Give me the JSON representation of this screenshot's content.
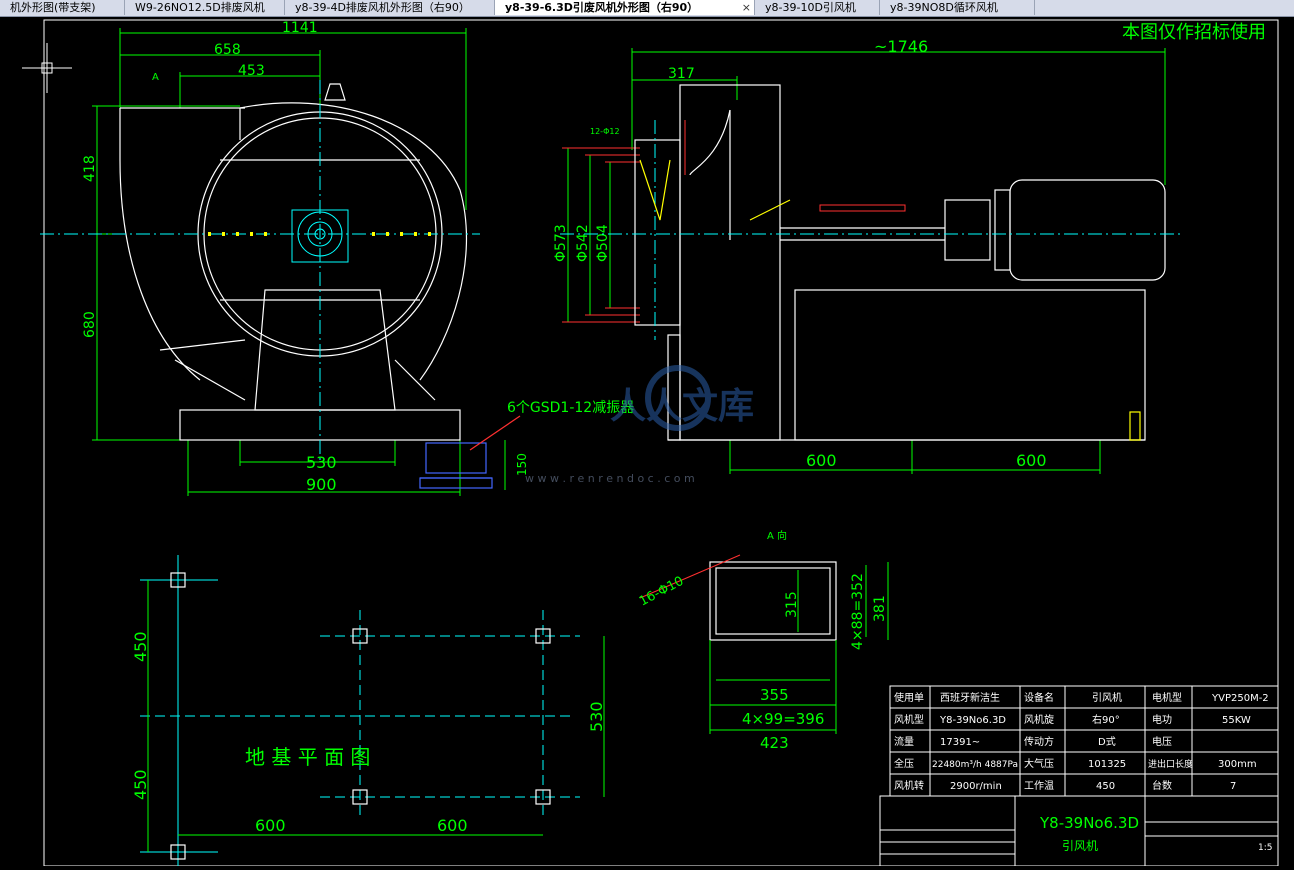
{
  "tabs": [
    {
      "label": "机外形图(带支架)",
      "active": false
    },
    {
      "label": "W9-26NO12.5D排废风机",
      "active": false
    },
    {
      "label": "y8-39-4D排废风机外形图（右90）",
      "active": false
    },
    {
      "label": "y8-39-6.3D引废风机外形图（右90）",
      "active": true
    },
    {
      "label": "y8-39-10D引风机",
      "active": false
    },
    {
      "label": "y8-39NO8D循环风机",
      "active": false
    }
  ],
  "close_glyph": "×",
  "drawing": {
    "note": "本图仅作招标使用",
    "front_dims": {
      "w1141": "1141",
      "w658": "658",
      "w453": "453",
      "h418": "418",
      "h680": "680",
      "w530": "530",
      "w900": "900",
      "h150": "150",
      "label_a": "A"
    },
    "damper_label": "6个GSD1-12减振器",
    "side_dims": {
      "w1746": "~1746",
      "w317": "317",
      "d573": "Φ573",
      "d542": "Φ542",
      "d504": "Φ504",
      "holes12": "12-Φ12",
      "s600a": "600",
      "s600b": "600"
    },
    "a_view": {
      "title": "A 向",
      "holes": "16-Φ10",
      "w355": "355",
      "w4x99": "4×99=396",
      "w423": "423",
      "h315": "315",
      "h4x88": "4×88=352",
      "h381": "381"
    },
    "foundation": {
      "title": "地 基 平 面 图",
      "h450a": "450",
      "h450b": "450",
      "h530": "530",
      "w600a": "600",
      "w600b": "600"
    },
    "watermark": {
      "text": "人人文库",
      "url": "w w w . r e n r e n d o c . c o m"
    },
    "title_block": {
      "rows": [
        [
          "使用单",
          "西班牙新洁生",
          "设备名",
          "引风机",
          "电机型",
          "YVP250M-2"
        ],
        [
          "风机型",
          "Y8-39No6.3D",
          "风机旋",
          "右90°",
          "电功",
          "55KW"
        ],
        [
          "流量",
          "17391~",
          "传动方",
          "D式",
          "电压",
          ""
        ],
        [
          "全压",
          "22480m³/h 4887Pa",
          "大气压",
          "101325",
          "进出口长度",
          "300mm"
        ],
        [
          "风机转",
          "2900r/min",
          "工作温",
          "450",
          "台数",
          "7"
        ]
      ],
      "drawing_name": "Y8-39No6.3D",
      "drawing_sub": "引风机",
      "scale": "1:5"
    }
  }
}
